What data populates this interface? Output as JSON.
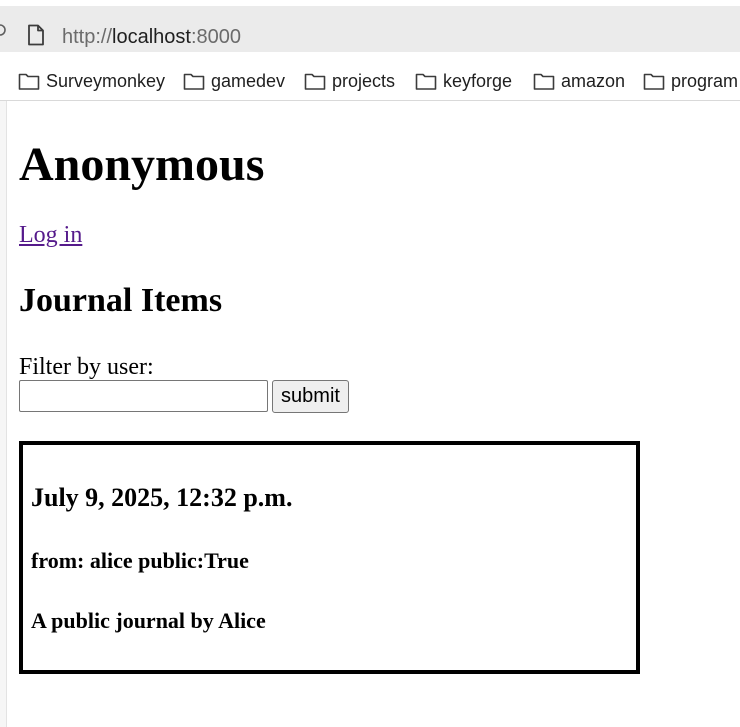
{
  "browser": {
    "url_scheme": "http://",
    "url_host": "localhost",
    "url_port": ":8000",
    "bookmarks": [
      {
        "label": "Surveymonkey",
        "icon": "folder-icon"
      },
      {
        "label": "gamedev",
        "icon": "folder-icon"
      },
      {
        "label": "projects",
        "icon": "folder-icon"
      },
      {
        "label": "keyforge",
        "icon": "folder-icon"
      },
      {
        "label": "amazon",
        "icon": "folder-icon"
      },
      {
        "label": "program",
        "icon": "folder-icon"
      }
    ]
  },
  "page": {
    "user_heading": "Anonymous",
    "login_link": "Log in",
    "section_heading": "Journal Items",
    "filter": {
      "label": "Filter by user:",
      "value": "",
      "submit_label": "submit"
    },
    "journal_items": [
      {
        "date": "July 9, 2025, 12:32 p.m.",
        "meta": "from: alice public:True",
        "body": "A public journal by Alice"
      }
    ]
  },
  "colors": {
    "link_visited": "#551a8b",
    "chrome_bar": "#ebebeb",
    "card_border": "#000000"
  }
}
